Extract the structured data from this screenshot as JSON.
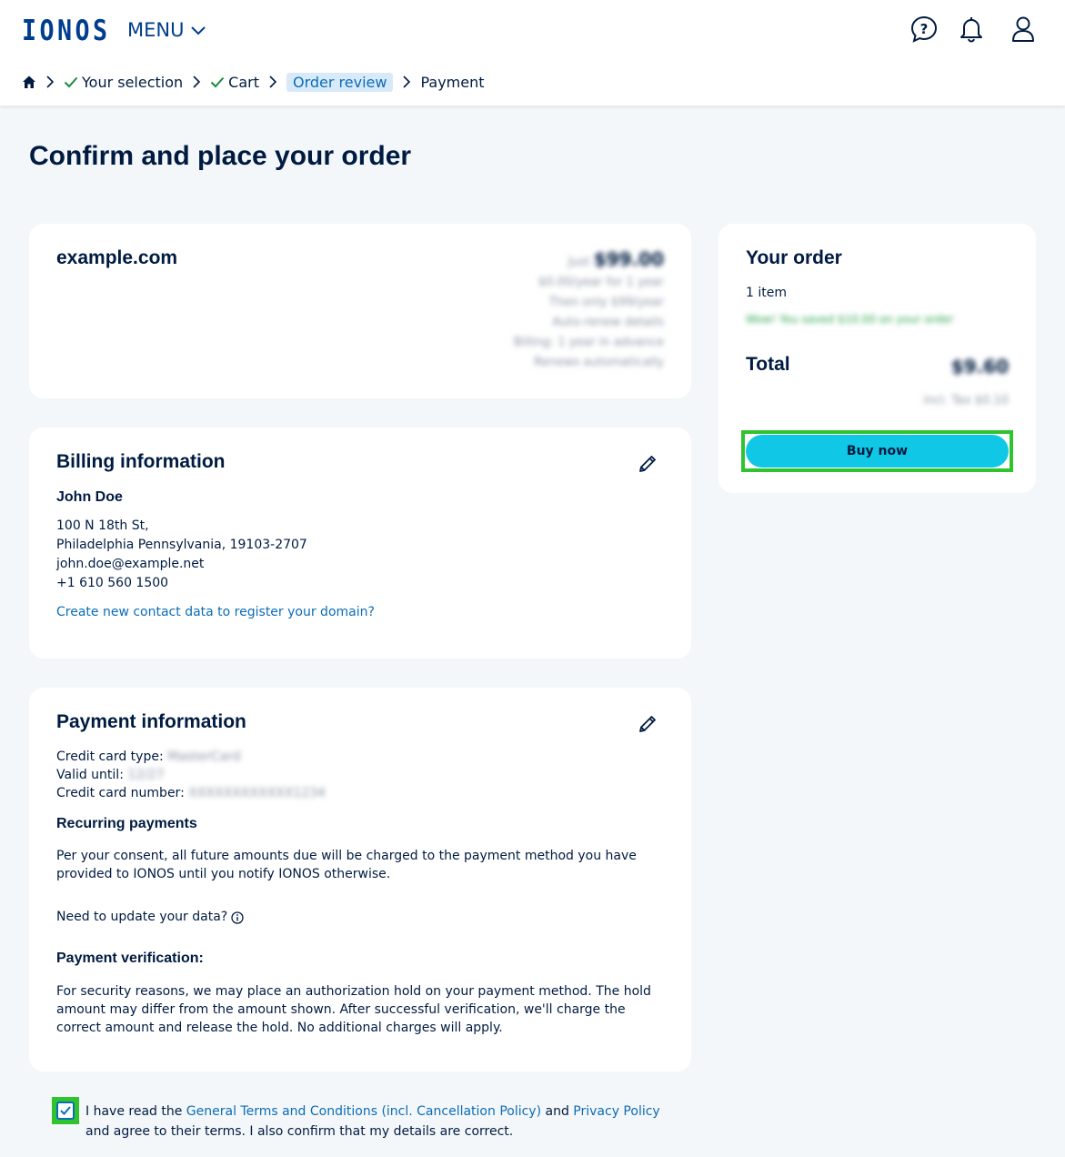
{
  "brand": {
    "logo_text": "IONOS",
    "accent": "#003d8f",
    "link": "#0b6db6",
    "button": "#11c7e6",
    "highlight": "#2fc42f"
  },
  "header": {
    "menu_label": "MENU"
  },
  "breadcrumb": {
    "items": [
      "Your selection",
      "Cart",
      "Order review",
      "Payment"
    ]
  },
  "page_title": "Confirm and place your order",
  "domain_card": {
    "name": "example.com",
    "price": "$99.00",
    "price_prefix": "Just",
    "details": [
      "$0.00/year for 1 year",
      "Then only $99/year",
      "Auto-renew details",
      "Billing: 1 year in advance",
      "Renews automatically"
    ]
  },
  "billing": {
    "title": "Billing information",
    "name": "John Doe",
    "address1": "100 N 18th St,",
    "address2": "Philadelphia Pennsylvania, 19103-2707",
    "email": "john.doe@example.net",
    "phone": "+1 610 560 1500",
    "link": "Create new contact data to register your domain?"
  },
  "payment": {
    "title": "Payment information",
    "card_type_label": "Credit card type:",
    "card_type_value": "MasterCard",
    "valid_until_label": "Valid until:",
    "valid_until_value": "12/27",
    "card_number_label": "Credit card number:",
    "card_number_value": "XXXXXXXXXXXX1234",
    "recurring_title": "Recurring payments",
    "recurring_text": "Per your consent, all future amounts due will be charged to the payment method you have provided to IONOS until you notify IONOS otherwise.",
    "update_text": "Need to update your data?",
    "verification_title": "Payment verification:",
    "verification_text": "For security reasons, we may place an authorization hold on your payment method. The hold amount may differ from the amount shown. After successful verification, we'll charge the correct amount and release the hold. No additional charges will apply."
  },
  "order": {
    "title": "Your order",
    "items": "1 item",
    "savings": "Wow! You saved $10.00 on your order",
    "total_label": "Total",
    "total_value": "$9.60",
    "tax_note": "incl. Tax $0.10",
    "buy_label": "Buy now"
  },
  "terms": {
    "prefix": "I have read the",
    "link1": "General Terms and Conditions (incl. Cancellation Policy)",
    "middle": "and",
    "link2": "Privacy Policy",
    "suffix": "and agree to their terms. I also confirm that my details are correct."
  }
}
